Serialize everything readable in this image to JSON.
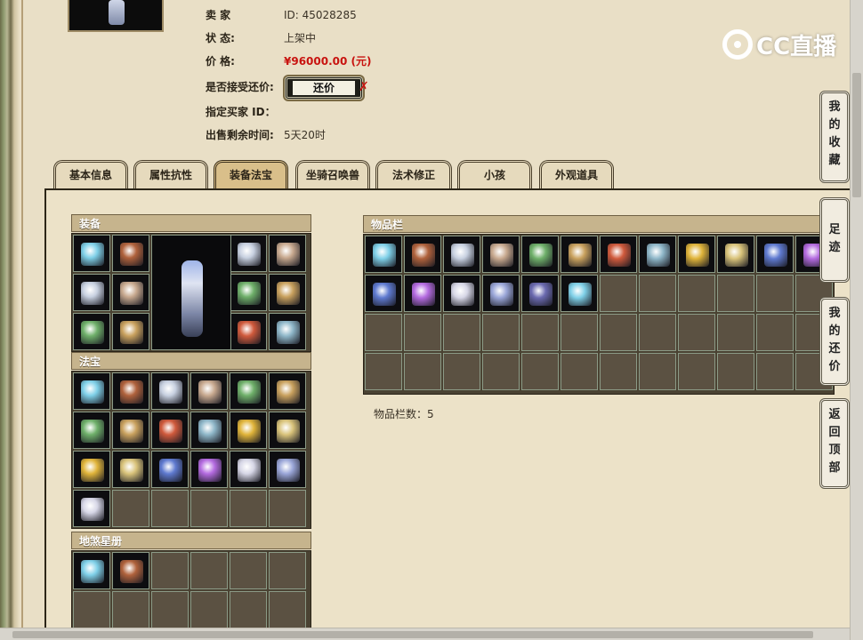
{
  "seller": {
    "rows": [
      {
        "label": "卖    家",
        "value": "ID:  45028285"
      },
      {
        "label": "状        态:",
        "value": "上架中"
      },
      {
        "label": "价        格:",
        "value": "¥96000.00 (元)"
      },
      {
        "label": "是否接受还价:",
        "value": ""
      },
      {
        "label": "指定买家 ID：",
        "value": ""
      },
      {
        "label": "出售剩余时间:",
        "value": "5天20时"
      }
    ],
    "counter_button": "还价",
    "counter_mark": "✗"
  },
  "logo": {
    "text": "CC直播"
  },
  "tabs": [
    {
      "label": "基本信息"
    },
    {
      "label": "属性抗性"
    },
    {
      "label": "装备法宝",
      "active": true
    },
    {
      "label": "坐骑召唤兽"
    },
    {
      "label": "法术修正"
    },
    {
      "label": "小孩"
    },
    {
      "label": "外观道具"
    }
  ],
  "panels": {
    "equipment": "装备",
    "treasure": "法宝",
    "star_book": "地煞星册",
    "inventory": "物品栏",
    "inventory_count": "物品栏数：5"
  },
  "side_nav": [
    {
      "label": [
        "我",
        "的",
        "收",
        "藏"
      ]
    },
    {
      "label": [
        "足",
        "迹"
      ]
    },
    {
      "label": [
        "我",
        "的",
        "还",
        "价"
      ]
    },
    {
      "label": [
        "返",
        "回",
        "顶",
        "部"
      ]
    }
  ],
  "colors": {
    "background": "#e9dfc6",
    "price": "#c8130f",
    "panel_header": "#c6b48d",
    "cell_empty": "#5b5142"
  }
}
